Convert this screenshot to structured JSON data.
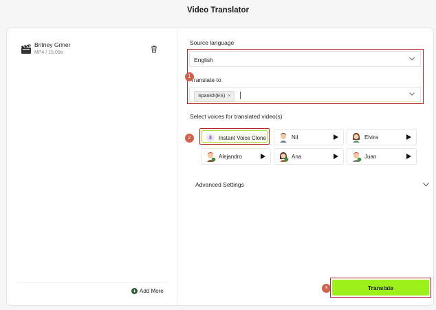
{
  "app": {
    "title": "Video Translator"
  },
  "file": {
    "name": "Britney Griner",
    "meta": "MP4 / 15.09s",
    "icon": "clapperboard-icon"
  },
  "sidebar": {
    "add_more_label": "Add More"
  },
  "source": {
    "label": "Source language",
    "value": "English"
  },
  "target": {
    "label": "Translate to",
    "tag": "Spanish(ES)",
    "tag_remove": "×"
  },
  "voices": {
    "label": "Select voices for translated video(s)",
    "items": [
      {
        "name": "Instant Voice Clone",
        "selected": true,
        "icon": "microphone-icon"
      },
      {
        "name": "Nil",
        "icon": "avatar-male-icon"
      },
      {
        "name": "Elvira",
        "icon": "avatar-female-icon"
      },
      {
        "name": "Alejandro",
        "icon": "avatar-male-icon"
      },
      {
        "name": "Ana",
        "icon": "avatar-female-icon"
      },
      {
        "name": "Juan",
        "icon": "avatar-male-icon"
      }
    ]
  },
  "advanced": {
    "label": "Advanced Settings"
  },
  "action": {
    "translate_label": "Translate"
  },
  "steps": [
    "1",
    "2",
    "3"
  ],
  "colors": {
    "accent": "#9ef01a",
    "highlight_border": "#b3242c",
    "step_badge": "#d0624d"
  }
}
